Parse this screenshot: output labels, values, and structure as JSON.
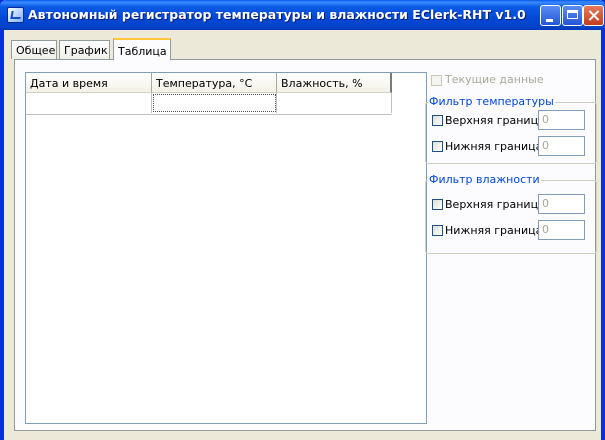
{
  "window": {
    "title": "Автономный регистратор температуры и влажности EClerk-RHT v1.0"
  },
  "tabs": [
    {
      "label": "Общее",
      "active": false
    },
    {
      "label": "График",
      "active": false
    },
    {
      "label": "Таблица",
      "active": true
    }
  ],
  "table": {
    "columns": [
      "Дата и время",
      "Температура, °С",
      "Влажность, %"
    ],
    "rows": [
      [
        "",
        "",
        ""
      ]
    ]
  },
  "current_data": {
    "label": "Текущие данные",
    "checked": false,
    "enabled": false
  },
  "temp_filter": {
    "title": "Фильтр температуры",
    "upper_label": "Верхняя граница",
    "upper_value": "0",
    "lower_label": "Нижняя граница",
    "lower_value": "0"
  },
  "humidity_filter": {
    "title": "Фильтр влажности",
    "upper_label": "Верхняя граница",
    "upper_value": "0",
    "lower_label": "Нижняя граница",
    "lower_value": "0"
  },
  "colors": {
    "titlebar": "#0248d7",
    "tab_highlight": "#ffc73c",
    "group_title": "#0046d5",
    "disabled_text": "#aca899",
    "close_button": "#c23d1c"
  }
}
